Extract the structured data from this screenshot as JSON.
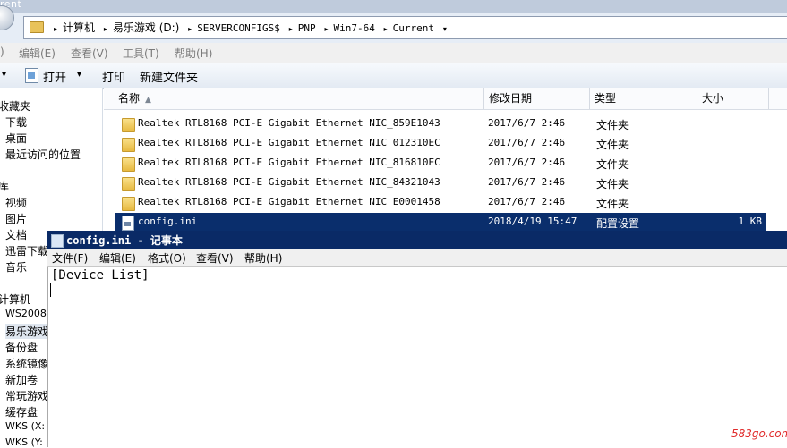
{
  "explorer": {
    "title_fragment": "rent",
    "breadcrumbs": [
      "计算机",
      "易乐游戏 (D:)",
      "SERVERCONFIGS$",
      "PNP",
      "Win7-64",
      "Current"
    ],
    "menu": [
      "编辑(E)",
      "查看(V)",
      "工具(T)",
      "帮助(H)"
    ],
    "menu_partial": ")",
    "toolbar": {
      "organize_fragment": "▾",
      "open": "打开",
      "print": "打印",
      "new_folder": "新建文件夹"
    },
    "nav_items": [
      "收藏夹",
      "下载",
      "桌面",
      "最近访问的位置",
      "库",
      "视频",
      "图片",
      "文档",
      "迅雷下载",
      "音乐",
      "计算机",
      "WS2008",
      "易乐游戏",
      "备份盘",
      "系统镜像",
      "新加卷",
      "常玩游戏",
      "缓存盘",
      "WKS (X:",
      "WKS (Y:"
    ],
    "columns": {
      "name": "名称",
      "date": "修改日期",
      "type": "类型",
      "size": "大小"
    },
    "files": [
      {
        "name": "Realtek RTL8168 PCI-E Gigabit Ethernet NIC_859E1043",
        "date": "2017/6/7 2:46",
        "type": "文件夹",
        "size": ""
      },
      {
        "name": "Realtek RTL8168 PCI-E Gigabit Ethernet NIC_012310EC",
        "date": "2017/6/7 2:46",
        "type": "文件夹",
        "size": ""
      },
      {
        "name": "Realtek RTL8168 PCI-E Gigabit Ethernet NIC_816810EC",
        "date": "2017/6/7 2:46",
        "type": "文件夹",
        "size": ""
      },
      {
        "name": "Realtek RTL8168 PCI-E Gigabit Ethernet NIC_84321043",
        "date": "2017/6/7 2:46",
        "type": "文件夹",
        "size": ""
      },
      {
        "name": "Realtek RTL8168 PCI-E Gigabit Ethernet NIC_E0001458",
        "date": "2017/6/7 2:46",
        "type": "文件夹",
        "size": ""
      },
      {
        "name": "config.ini",
        "date": "2018/4/19 15:47",
        "type": "配置设置",
        "size": "1 KB"
      }
    ]
  },
  "notepad": {
    "title": "config.ini - 记事本",
    "menu": [
      "文件(F)",
      "编辑(E)",
      "格式(O)",
      "查看(V)",
      "帮助(H)"
    ],
    "content": "[Device List]"
  },
  "watermark": "583go.com",
  "colors": {
    "selection": "#0a2e6c",
    "title_bar": "#0a2a66",
    "watermark": "#e02a2a"
  }
}
